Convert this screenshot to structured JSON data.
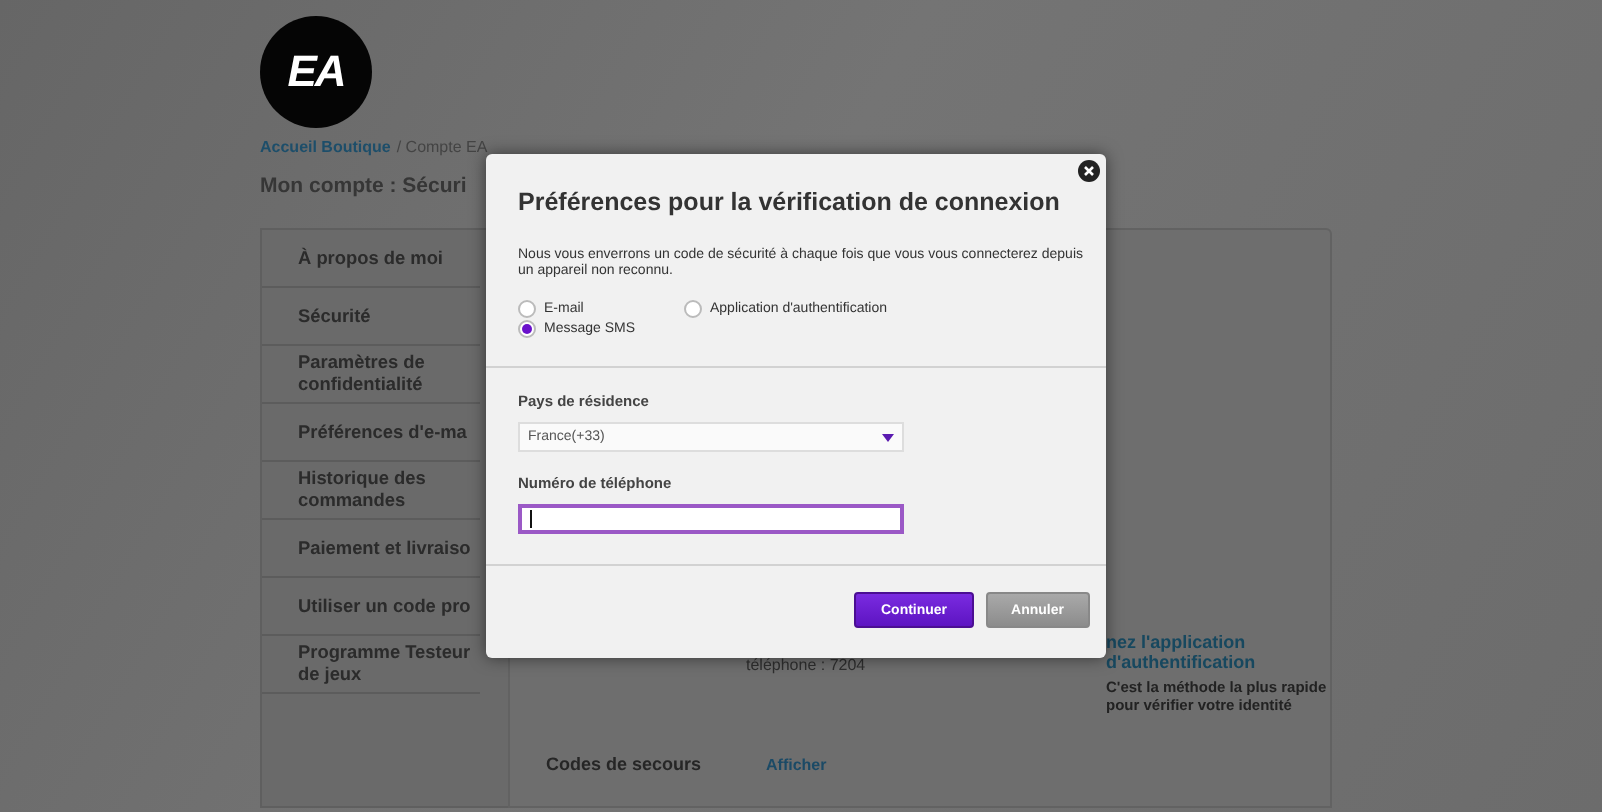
{
  "header": {
    "logo": "EA",
    "breadcrumb_link": "Accueil Boutique",
    "breadcrumb_rest": "/ Compte EA"
  },
  "page_title": "Mon compte : Sécuri",
  "sidebar": {
    "items": [
      {
        "label": "À propos de moi"
      },
      {
        "label": "Sécurité"
      },
      {
        "label": "Paramètres de confidentialité"
      },
      {
        "label": "Préférences d'e-ma"
      },
      {
        "label": "Historique des commandes"
      },
      {
        "label": "Paiement et livraiso"
      },
      {
        "label": "Utiliser un code pro"
      },
      {
        "label": "Programme Testeur de jeux"
      }
    ]
  },
  "main": {
    "phone_text": "téléphone : 7204",
    "auth_link": "nez l'application d'authentification",
    "auth_note": "C'est la méthode la plus rapide pour vérifier votre identité",
    "backup_label": "Codes de secours",
    "backup_action": "Afficher"
  },
  "modal": {
    "title": "Préférences pour la vérification de connexion",
    "description": "Nous vous enverrons un code de sécurité à chaque fois que vous vous connecterez depuis un appareil non reconnu.",
    "options": [
      {
        "label": "E-mail",
        "selected": false
      },
      {
        "label": "Application d'authentification",
        "selected": false
      },
      {
        "label": "Message SMS",
        "selected": true
      }
    ],
    "country": {
      "label": "Pays de résidence",
      "value": "France(+33)"
    },
    "phone": {
      "label": "Numéro de téléphone",
      "focused": true
    },
    "buttons": [
      {
        "label": "Continuer",
        "kind": "primary"
      },
      {
        "label": "Annuler",
        "kind": "secondary"
      }
    ]
  }
}
